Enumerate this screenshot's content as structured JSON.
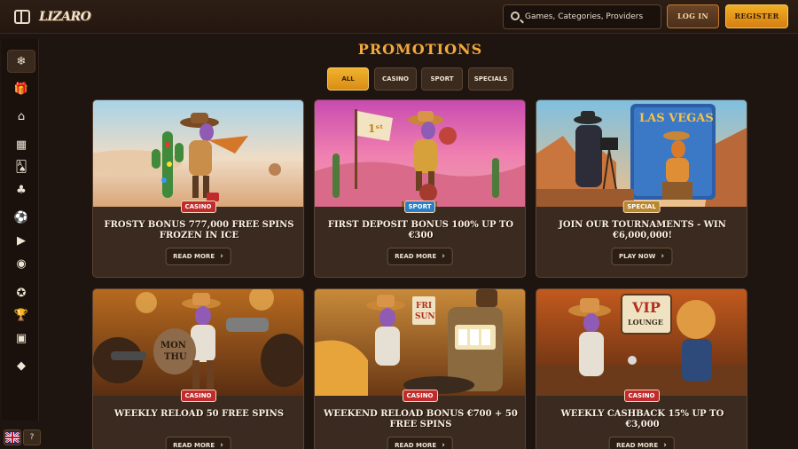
{
  "header": {
    "logo": "LIZARO",
    "search_placeholder": "Games, Categories, Providers",
    "login_label": "LOG IN",
    "register_label": "REGISTER"
  },
  "sidebar": {
    "items": [
      {
        "icon": "snowflake-icon",
        "glyph": "❄"
      },
      {
        "icon": "gift-icon",
        "glyph": "🎁"
      },
      {
        "icon": "home-icon",
        "glyph": "⌂"
      },
      {
        "icon": "treasure-chest-icon",
        "glyph": "▦"
      },
      {
        "icon": "cards-icon",
        "glyph": "🂡"
      },
      {
        "icon": "clover-icon",
        "glyph": "♣"
      },
      {
        "icon": "soccer-ball-icon",
        "glyph": "⚽"
      },
      {
        "icon": "play-icon",
        "glyph": "▶"
      },
      {
        "icon": "live-icon",
        "glyph": "◉"
      },
      {
        "icon": "badge-icon",
        "glyph": "✪"
      },
      {
        "icon": "trophy-icon",
        "glyph": "🏆"
      },
      {
        "icon": "shop-icon",
        "glyph": "▣"
      },
      {
        "icon": "diamond-icon",
        "glyph": "◆"
      }
    ],
    "language_flag": "GB",
    "help_glyph": "?"
  },
  "page": {
    "title": "PROMOTIONS",
    "tabs": [
      "ALL",
      "CASINO",
      "SPORT",
      "SPECIALS"
    ]
  },
  "promotions": [
    {
      "badge": "CASINO",
      "title": "FROSTY BONUS 777,000 FREE SPINS FROZEN IN ICE",
      "button": "READ MORE"
    },
    {
      "badge": "SPORT",
      "title": "FIRST DEPOSIT BONUS 100% UP TO €300",
      "button": "READ MORE"
    },
    {
      "badge": "SPECIAL",
      "title": "JOIN OUR TOURNAMENTS - WIN €6,000,000!",
      "button": "PLAY NOW"
    },
    {
      "badge": "CASINO",
      "title": "WEEKLY RELOAD 50 FREE SPINS",
      "button": "READ MORE"
    },
    {
      "badge": "CASINO",
      "title": "WEEKEND RELOAD BONUS €700 + 50 FREE SPINS",
      "button": "READ MORE"
    },
    {
      "badge": "CASINO",
      "title": "WEEKLY CASHBACK 15% UP TO €3,000",
      "button": "READ MORE"
    }
  ],
  "image_text": {
    "vegas_sign": "LAS VEGAS",
    "vip_sign_1": "VIP",
    "vip_sign_2": "LOUNGE",
    "bag_text_1": "MON",
    "bag_text_2": "THU",
    "sign_text_1": "FRI",
    "sign_text_2": "SUN"
  }
}
